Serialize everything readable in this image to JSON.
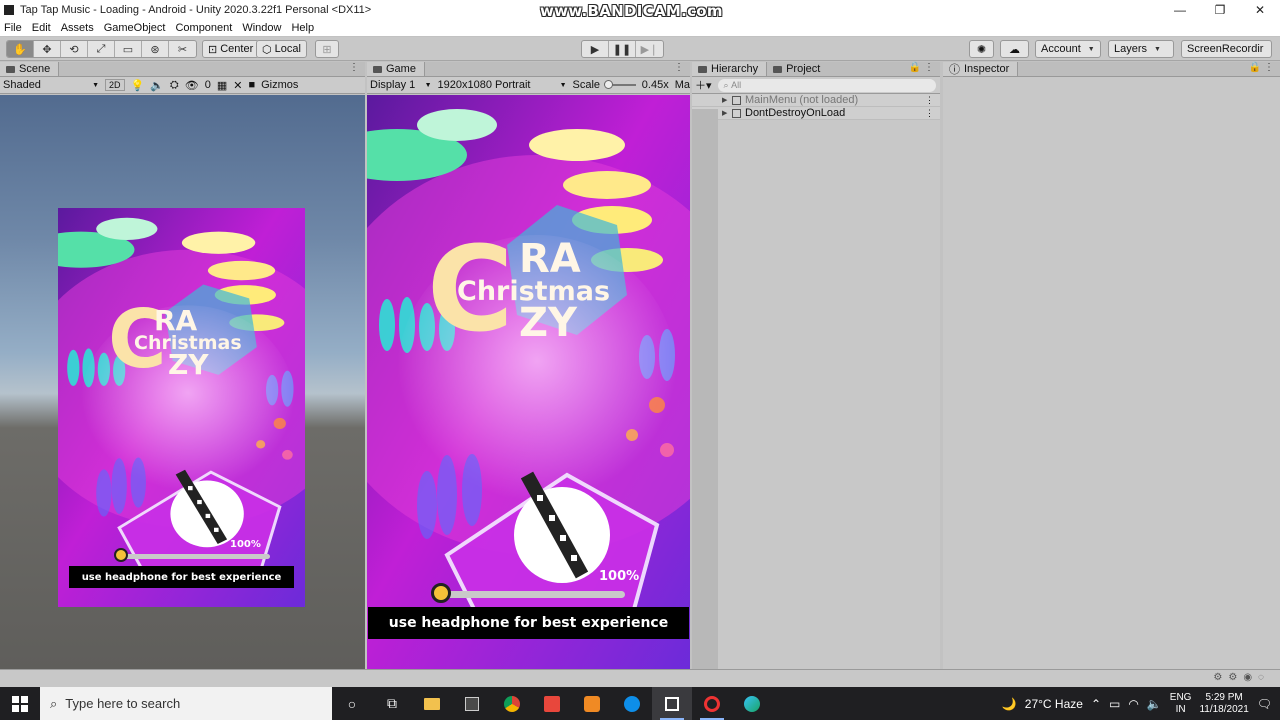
{
  "window": {
    "title": "Tap Tap Music - Loading - Android - Unity 2020.3.22f1 Personal <DX11>",
    "watermark": "www.BANDICAM.com",
    "controls": [
      "—",
      "❐",
      "✕"
    ]
  },
  "menu": [
    "File",
    "Edit",
    "Assets",
    "GameObject",
    "Component",
    "Window",
    "Help"
  ],
  "toolbar": {
    "pivot_label": "Center",
    "space_label": "Local",
    "account_label": "Account",
    "layers_label": "Layers",
    "layout_label": "ScreenRecordir"
  },
  "scene": {
    "tab": "Scene",
    "draw_mode": "Shaded",
    "mode_2d": "2D",
    "hidden_count": "0",
    "gizmos": "Gizmos"
  },
  "game": {
    "tab": "Game",
    "display": "Display 1",
    "resolution": "1920x1080 Portrait",
    "scale_label": "Scale",
    "scale_value": "0.45x",
    "extra": "Ma",
    "splash": {
      "title_big": "C",
      "title_top": "RA",
      "title_mid": "Christmas",
      "title_bottom": "ZY",
      "progress_text": "100%",
      "progress": 1.0,
      "hint": "use headphone for best experience"
    }
  },
  "hierarchy": {
    "tab": "Hierarchy",
    "project_tab": "Project",
    "search_placeholder": "All",
    "items": [
      {
        "label": "MainMenu (not loaded)",
        "dim": true
      },
      {
        "label": "DontDestroyOnLoad",
        "dim": false
      }
    ]
  },
  "inspector": {
    "tab": "Inspector"
  },
  "taskbar": {
    "search_placeholder": "Type here to search",
    "weather": "27°C  Haze",
    "lang_top": "ENG",
    "lang_bottom": "IN",
    "time": "5:29 PM",
    "date": "11/18/2021"
  }
}
